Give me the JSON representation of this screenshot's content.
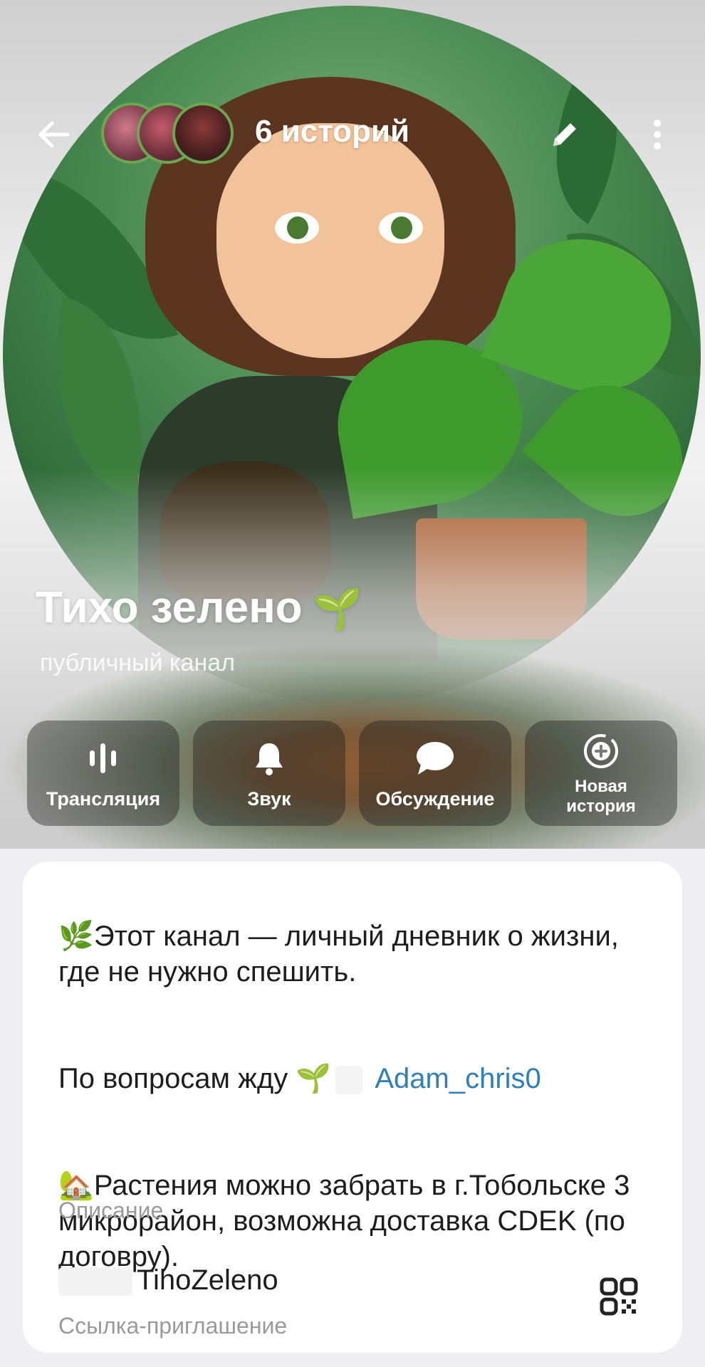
{
  "header": {
    "stories_count_label": "6 историй",
    "title": "Тихо зелено",
    "title_emoji": "🌱",
    "subtitle": "публичный канал"
  },
  "actions": [
    {
      "label": "Трансляция",
      "icon": "live-bars-icon"
    },
    {
      "label": "Звук",
      "icon": "bell-icon"
    },
    {
      "label": "Обсуждение",
      "icon": "chat-bubble-icon"
    },
    {
      "label": "Новая\nистория",
      "icon": "add-story-icon"
    }
  ],
  "description": {
    "line1_emoji": "🌿",
    "line1": "Этот канал — личный дневник о жизни, где не нужно спешить.",
    "line2_prefix": "По вопросам жду",
    "line2_emoji": "🌱",
    "line2_link": "Adam_chris0",
    "line3_emoji": "🏡",
    "line3": "Растения можно забрать в г.Тобольске  3 микрорайон, возможна доставка CDEK (по договру).",
    "label": "Описание"
  },
  "invite": {
    "value": "TihoZeleno",
    "label": "Ссылка-приглашение"
  },
  "colors": {
    "link": "#2f7fb8",
    "accent_green": "#5ea832"
  }
}
